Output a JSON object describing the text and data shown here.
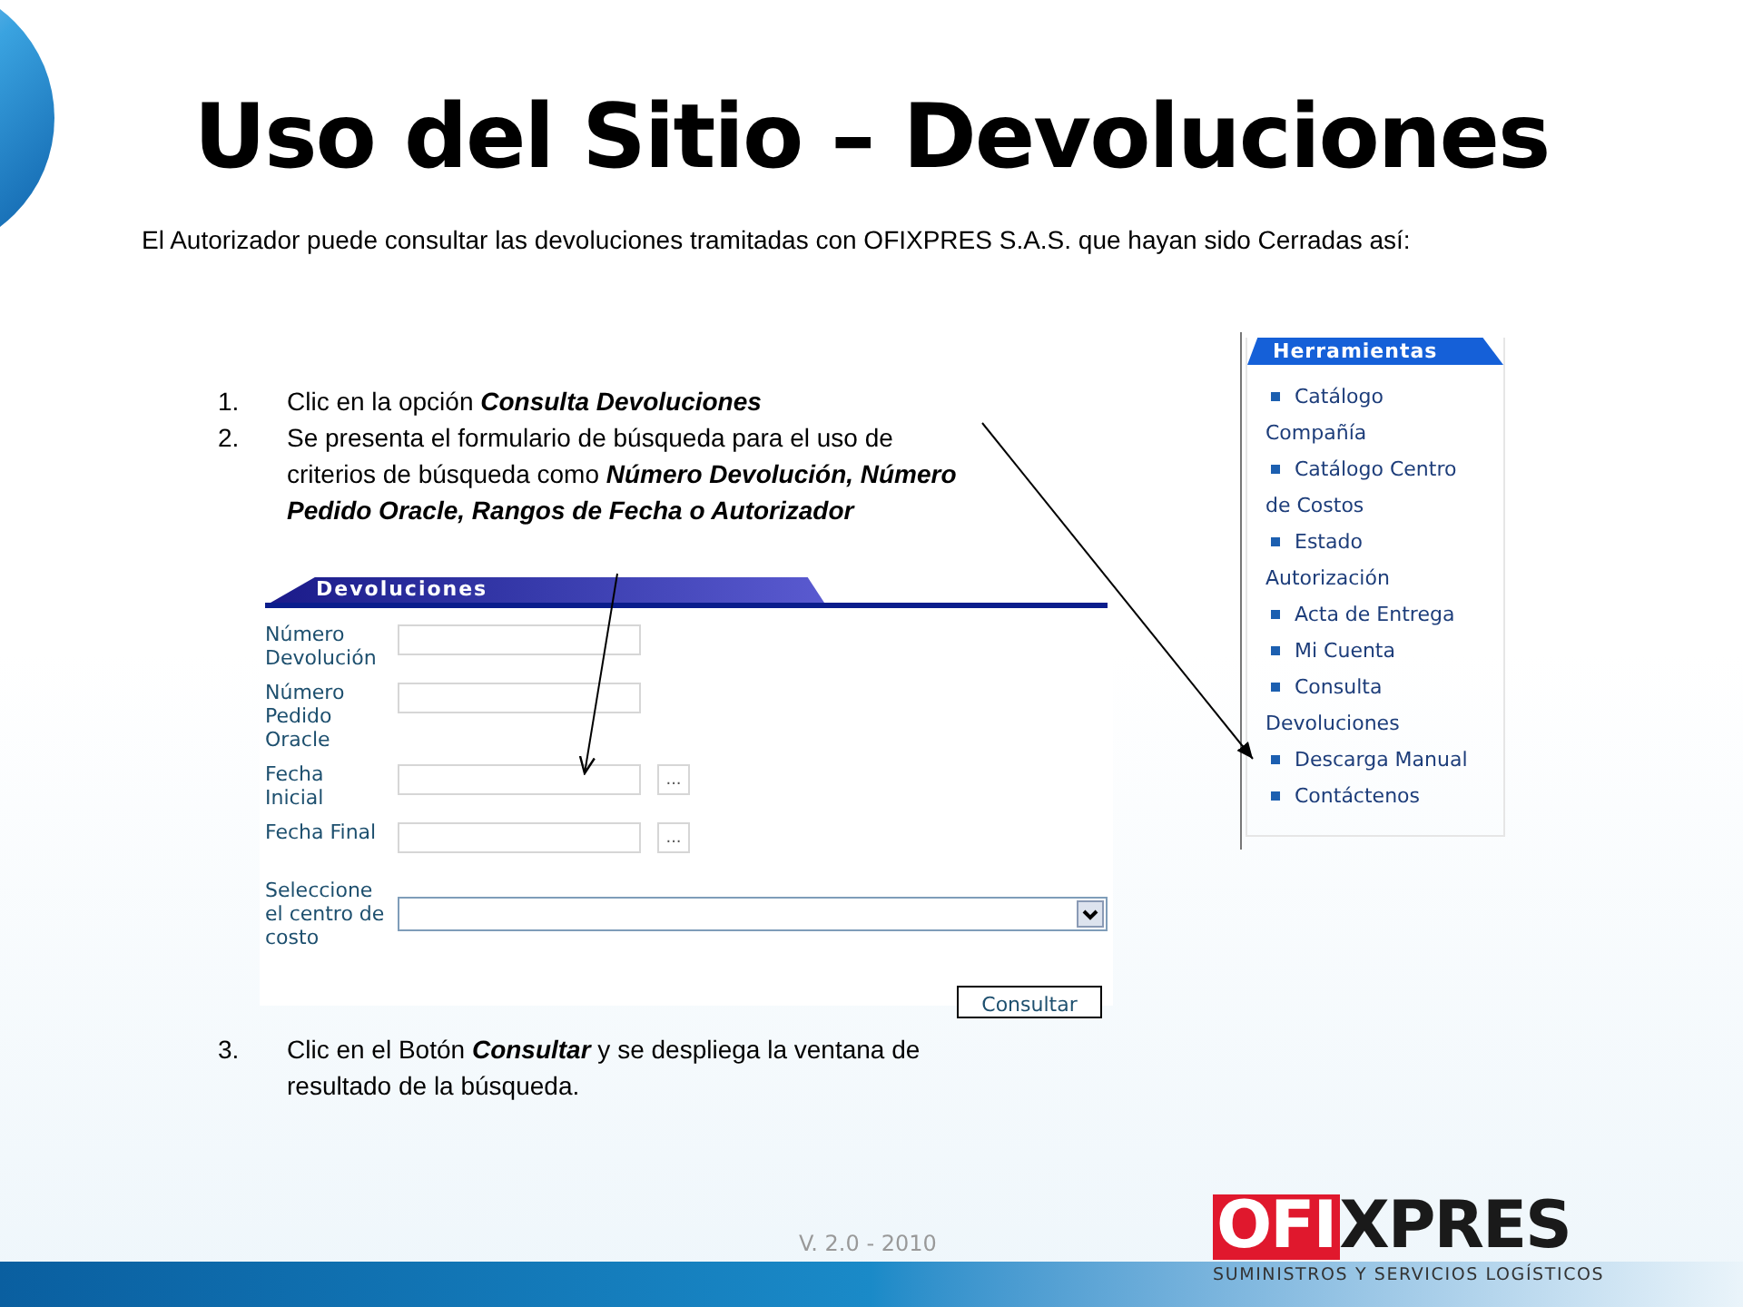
{
  "title": "Uso del Sitio – Devoluciones",
  "intro": "El Autorizador puede consultar las devoluciones tramitadas con OFIXPRES S.A.S. que hayan sido Cerradas así:",
  "steps": [
    {
      "number": "1.",
      "text": "Clic en la opción **Consulta Devoluciones**"
    },
    {
      "number": "2.",
      "text": "Se presenta el formulario de búsqueda para el uso de criterios de búsqueda como **Número Devolución, Número Pedido Oracle, Rangos de Fecha o Autorizador**"
    }
  ],
  "form": {
    "title": "Devoluciones",
    "fields": [
      {
        "label": "Número Devolución",
        "kind": "text"
      },
      {
        "label": "Número Pedido Oracle",
        "kind": "text"
      },
      {
        "label": "Fecha Inicial",
        "kind": "date",
        "button": "..."
      },
      {
        "label": "Fecha Final",
        "kind": "date",
        "button": "..."
      },
      {
        "label": "Seleccione el centro de costo",
        "kind": "select"
      }
    ],
    "submit": "Consultar"
  },
  "final_step": {
    "number": "3.",
    "text": "Clic en el Botón **Consultar** y se despliega la ventana de resultado de la búsqueda."
  },
  "menu": {
    "title": "Herramientas",
    "items": [
      "Catálogo Compañía",
      "Catálogo Centro de Costos",
      "Estado Autorización",
      "Acta de Entrega",
      "Mi Cuenta",
      "Consulta Devoluciones",
      "Descarga Manual",
      "Contáctenos"
    ]
  },
  "footer": {
    "version": "V. 2.0 - 2010",
    "logo_left": "OFI",
    "logo_right": "XPRES",
    "tagline": "SUMINISTROS Y SERVICIOS LOGÍSTICOS"
  }
}
